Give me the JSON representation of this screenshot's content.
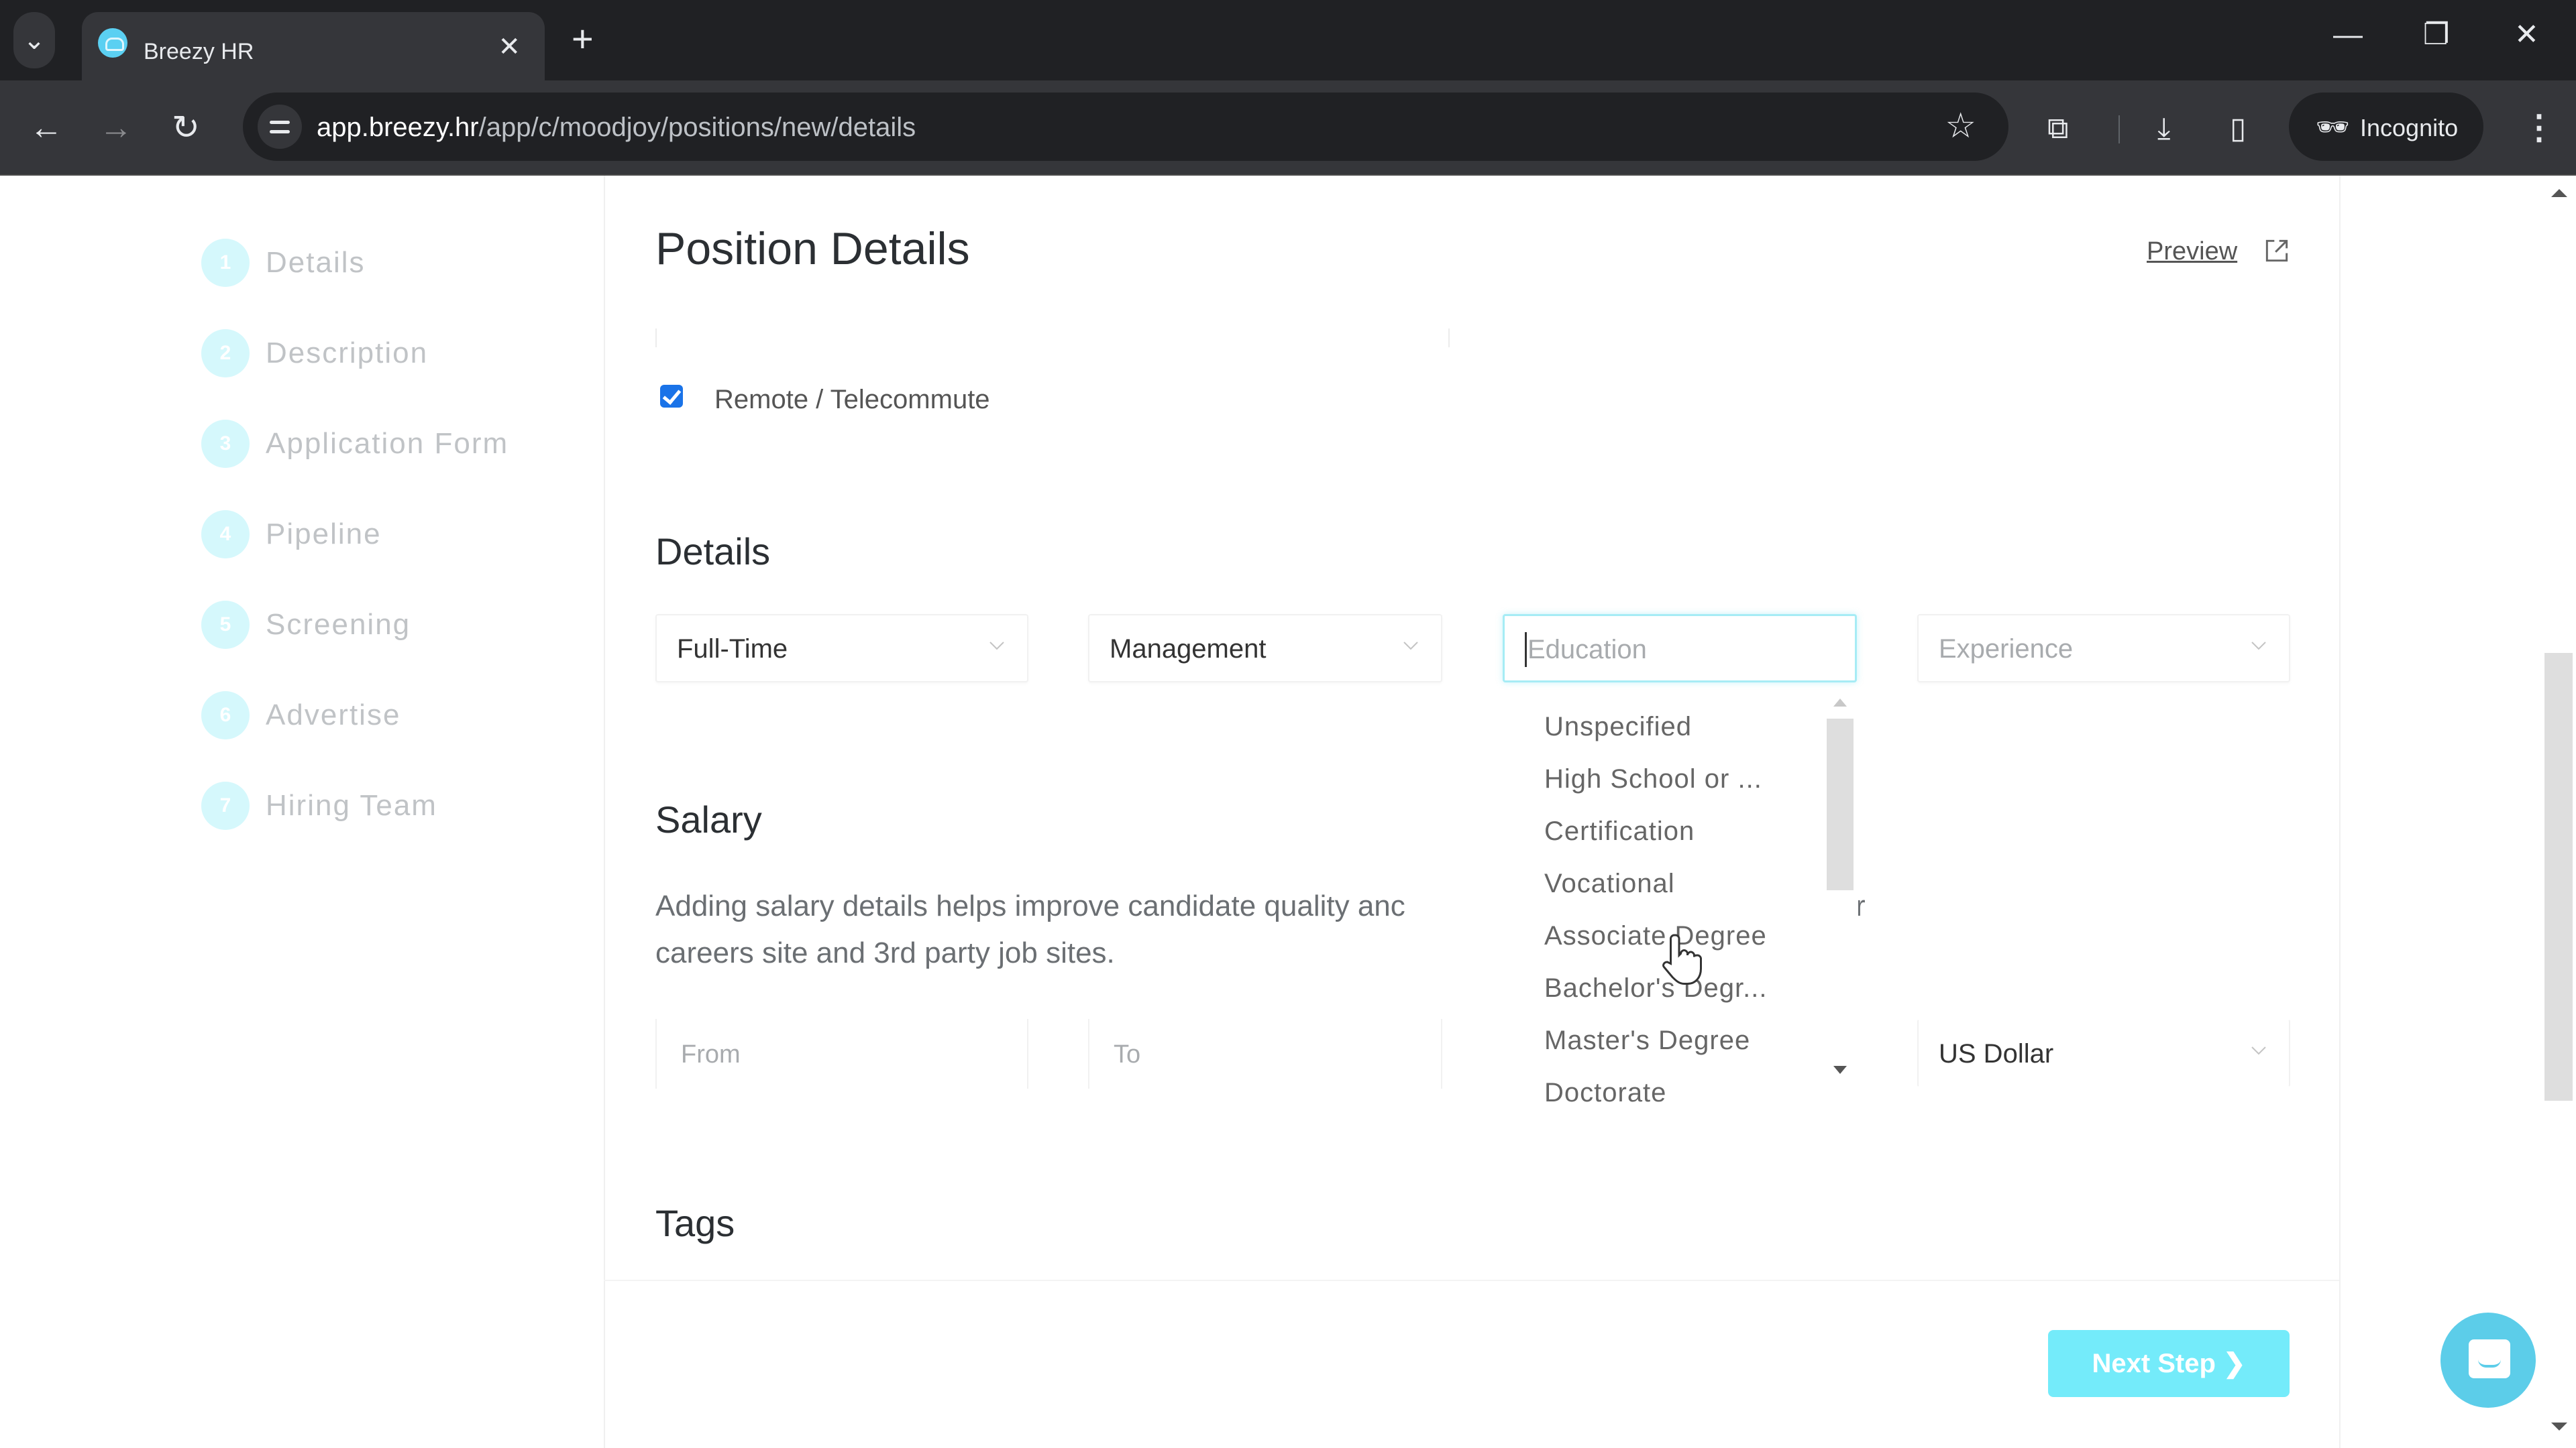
{
  "browser": {
    "tab_title": "Breezy HR",
    "url_host": "app.breezy.hr",
    "url_path": "/app/c/moodjoy/positions/new/details",
    "profile_label": "Incognito",
    "icons": {
      "tab_search": "chevron-down-icon",
      "tab_close": "close-icon",
      "new_tab": "plus-icon",
      "back": "arrow-left-icon",
      "forward": "arrow-right-icon",
      "reload": "reload-icon",
      "site_info": "tune-icon",
      "bookmark": "star-icon",
      "extensions": "puzzle-icon",
      "downloads": "download-icon",
      "side_panel": "side-panel-icon",
      "incognito": "incognito-icon",
      "menu": "kebab-menu-icon",
      "minimize": "minimize-icon",
      "restore": "restore-icon",
      "close_window": "close-icon"
    },
    "glyphs": {
      "tab_search": "⌄",
      "tab_close": "✕",
      "new_tab": "+",
      "back": "←",
      "forward": "→",
      "reload": "↻",
      "bookmark": "☆",
      "extensions": "⧉",
      "downloads": "⤓",
      "side_panel": "▯",
      "incognito": "🕶",
      "menu": "⋮",
      "minimize": "—",
      "restore": "❐",
      "close_window": "✕"
    }
  },
  "sidebar": {
    "steps": [
      {
        "number": "1",
        "label": "Details"
      },
      {
        "number": "2",
        "label": "Description"
      },
      {
        "number": "3",
        "label": "Application Form"
      },
      {
        "number": "4",
        "label": "Pipeline"
      },
      {
        "number": "5",
        "label": "Screening"
      },
      {
        "number": "6",
        "label": "Advertise"
      },
      {
        "number": "7",
        "label": "Hiring Team"
      }
    ]
  },
  "main": {
    "title": "Position Details",
    "preview_label": "Preview",
    "remote_checkbox": {
      "label": "Remote / Telecommute",
      "checked": true
    },
    "details": {
      "heading": "Details",
      "employment_type": "Full-Time",
      "category": "Management",
      "education_placeholder": "Education",
      "experience_placeholder": "Experience"
    },
    "education_dropdown": {
      "options": [
        "Unspecified",
        "High School or ...",
        "Certification",
        "Vocational",
        "Associate Degree",
        "Bachelor's Degr...",
        "Master's Degree",
        "Doctorate"
      ]
    },
    "salary": {
      "heading": "Salary",
      "description_line1": "Adding salary details helps improve candidate quality anc",
      "description_fragment": "r",
      "description_line2": "careers site and 3rd party job sites.",
      "from_placeholder": "From",
      "to_placeholder": "To",
      "currency": "US Dollar"
    },
    "tags": {
      "heading": "Tags"
    },
    "next_step_label": "Next Step ❯"
  },
  "colors": {
    "accent": "#74ebfa",
    "chat": "#5ccde9",
    "checkbox": "#1a73e8",
    "step_circle": "#d5f8fc"
  }
}
